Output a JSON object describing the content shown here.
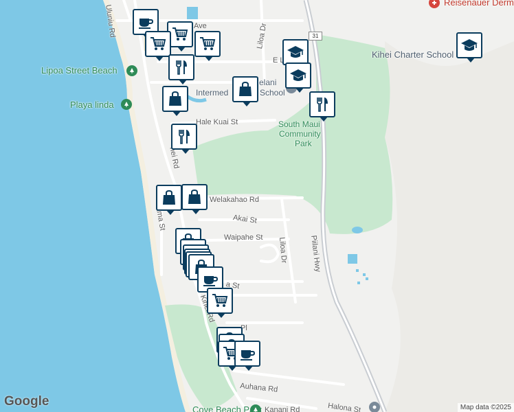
{
  "map": {
    "attribution": "Map data ©2025",
    "google_logo": "Google",
    "colors": {
      "water": "#7ec8e6",
      "land": "#f1f1ef",
      "park": "#c8e8cf",
      "marker_border": "#0b3c5d",
      "road": "#ffffff",
      "highway": "#c9cdd2"
    },
    "labels": [
      {
        "id": "uluniu-rd",
        "text": "Uluniu Rd",
        "kind": "road"
      },
      {
        "id": "lipoa-beach",
        "text": "Lipoa Street Beach",
        "kind": "poi"
      },
      {
        "id": "playa-linda",
        "text": "Playa linda",
        "kind": "poi"
      },
      {
        "id": "liloa-dr-north",
        "text": "Liloa Dr",
        "kind": "road"
      },
      {
        "id": "ave",
        "text": "Ave",
        "kind": "road"
      },
      {
        "id": "e-l",
        "text": "E L",
        "kind": "road"
      },
      {
        "id": "intermed",
        "text": "Intermed",
        "kind": "school"
      },
      {
        "id": "elani",
        "text": "elani",
        "kind": "school"
      },
      {
        "id": "school",
        "text": "School",
        "kind": "school"
      },
      {
        "id": "hale-kuai",
        "text": "Hale Kuai St",
        "kind": "road"
      },
      {
        "id": "park-line1",
        "text": "South Maui",
        "kind": "park"
      },
      {
        "id": "park-line2",
        "text": "Community",
        "kind": "park"
      },
      {
        "id": "park-line3",
        "text": "Park",
        "kind": "park"
      },
      {
        "id": "kihei-rd-1",
        "text": "hei Rd",
        "kind": "road"
      },
      {
        "id": "kihei-charter",
        "text": "Kihei Charter School",
        "kind": "school"
      },
      {
        "id": "reisenauer",
        "text": "Reisenauer Derm",
        "kind": "red"
      },
      {
        "id": "welakahao",
        "text": "Welakahao Rd",
        "kind": "road"
      },
      {
        "id": "akai",
        "text": "Akai St",
        "kind": "road"
      },
      {
        "id": "waipahe",
        "text": "Waipahe St",
        "kind": "road"
      },
      {
        "id": "alama",
        "text": "lama St",
        "kind": "road"
      },
      {
        "id": "liloa-dr-south",
        "text": "Liloa Dr",
        "kind": "road"
      },
      {
        "id": "piilani",
        "text": "Piilani Hwy",
        "kind": "road"
      },
      {
        "id": "st-fragment",
        "text": "a St",
        "kind": "road"
      },
      {
        "id": "kihei-rd-2",
        "text": "Kihei Rd",
        "kind": "road"
      },
      {
        "id": "pl",
        "text": "Pl",
        "kind": "road"
      },
      {
        "id": "auhana",
        "text": "Auhana Rd",
        "kind": "road"
      },
      {
        "id": "halona",
        "text": "Halona St",
        "kind": "road"
      },
      {
        "id": "kanani",
        "text": "Kanani Rd",
        "kind": "road"
      },
      {
        "id": "cove-beach",
        "text": "Cove Beach Park",
        "kind": "poi"
      },
      {
        "id": "highway-31",
        "text": "31",
        "kind": "shield"
      }
    ],
    "markers": [
      {
        "type": "coffee"
      },
      {
        "type": "shopping-cart"
      },
      {
        "type": "shopping-cart"
      },
      {
        "type": "shopping-cart"
      },
      {
        "type": "school"
      },
      {
        "type": "restaurant"
      },
      {
        "type": "school"
      },
      {
        "type": "shopping-bag"
      },
      {
        "type": "shopping-bag"
      },
      {
        "type": "restaurant"
      },
      {
        "type": "school"
      },
      {
        "type": "restaurant"
      },
      {
        "type": "shopping-bag"
      },
      {
        "type": "shopping-bag"
      },
      {
        "type": "shopping-bag"
      },
      {
        "type": "shopping-bag"
      },
      {
        "type": "shopping-bag"
      },
      {
        "type": "shopping-bag"
      },
      {
        "type": "shopping-bag"
      },
      {
        "type": "shopping-bag"
      },
      {
        "type": "coffee"
      },
      {
        "type": "shopping-cart"
      },
      {
        "type": "shopping-bag"
      },
      {
        "type": "shopping-bag"
      },
      {
        "type": "shopping-cart"
      },
      {
        "type": "coffee"
      }
    ]
  }
}
